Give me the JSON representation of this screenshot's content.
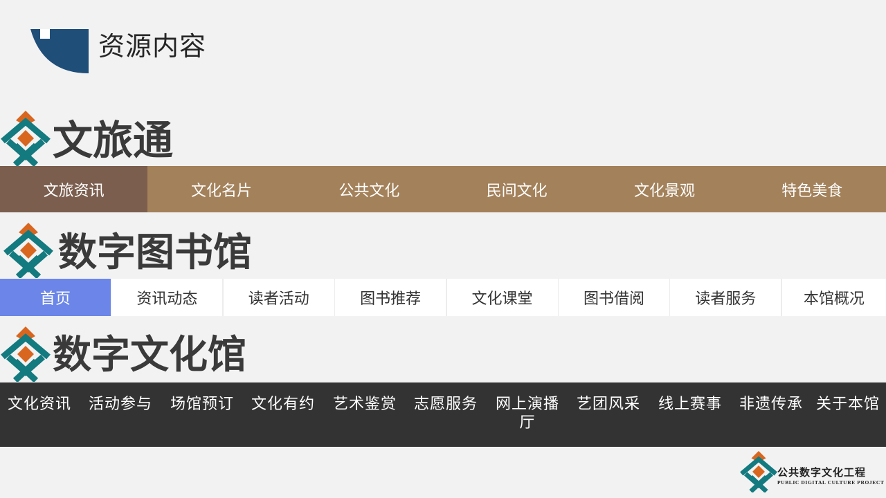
{
  "header": {
    "title": "资源内容"
  },
  "sections": [
    {
      "title": "文旅通",
      "nav": [
        {
          "label": "文旅资讯",
          "active": true
        },
        {
          "label": "文化名片"
        },
        {
          "label": "公共文化"
        },
        {
          "label": "民间文化"
        },
        {
          "label": "文化景观"
        },
        {
          "label": "特色美食"
        }
      ]
    },
    {
      "title": "数字图书馆",
      "nav": [
        {
          "label": "首页",
          "active": true
        },
        {
          "label": "资讯动态"
        },
        {
          "label": "读者活动"
        },
        {
          "label": "图书推荐"
        },
        {
          "label": "文化课堂"
        },
        {
          "label": "图书借阅"
        },
        {
          "label": "读者服务"
        },
        {
          "label": "本馆概况"
        }
      ]
    },
    {
      "title": "数字文化馆",
      "nav": [
        {
          "label": "文化资讯"
        },
        {
          "label": "活动参与"
        },
        {
          "label": "场馆预订"
        },
        {
          "label": "文化有约"
        },
        {
          "label": "艺术鉴赏"
        },
        {
          "label": "志愿服务"
        },
        {
          "label": "网上演播厅"
        },
        {
          "label": "艺团风采"
        },
        {
          "label": "线上赛事"
        },
        {
          "label": "非遗传承"
        },
        {
          "label": "关于本馆"
        }
      ]
    }
  ],
  "footer": {
    "brand_cn": "公共数字文化工程",
    "brand_en": "PUBLIC DIGITAL CULTURE PROJECT"
  },
  "colors": {
    "logo_orange": "#d9661f",
    "logo_teal": "#137a7f",
    "header_blue": "#1f4e79",
    "nav1_bg": "#a3815a",
    "nav1_active": "#7b5e4e",
    "nav2_active": "#6b86e8",
    "nav3_bg": "#333333"
  }
}
